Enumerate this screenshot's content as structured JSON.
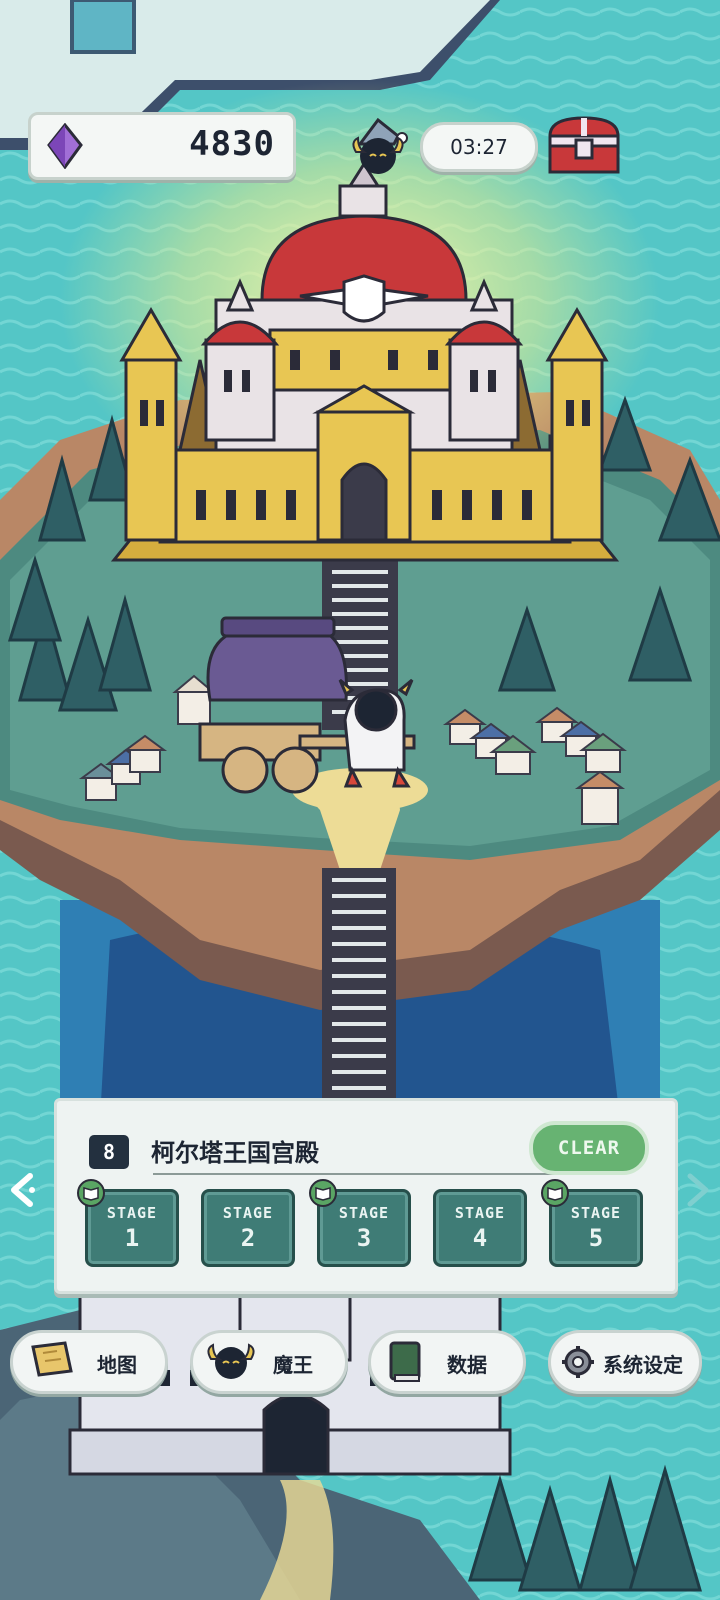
{
  "hud": {
    "gems": "4830",
    "timer": "03:27",
    "gem_icon": "purple-crystal-icon",
    "chest_icon": "treasure-chest-icon",
    "avatar_icon": "demon-king-avatar-icon"
  },
  "stage_panel": {
    "number": "8",
    "title": "柯尔塔王国宫殿",
    "clear_label": "CLEAR",
    "stages": [
      {
        "label": "STAGE",
        "num": "1",
        "has_book": true
      },
      {
        "label": "STAGE",
        "num": "2",
        "has_book": false
      },
      {
        "label": "STAGE",
        "num": "3",
        "has_book": true
      },
      {
        "label": "STAGE",
        "num": "4",
        "has_book": false
      },
      {
        "label": "STAGE",
        "num": "5",
        "has_book": true
      }
    ]
  },
  "menu": {
    "map": "地图",
    "demon_king": "魔王",
    "data": "数据",
    "settings": "系统设定"
  },
  "colors": {
    "sea": "#54c6c6",
    "castle_gold": "#e8c653",
    "roof_red": "#c8383a",
    "clear_green": "#67b372",
    "stage_teal": "#3f7c76"
  }
}
